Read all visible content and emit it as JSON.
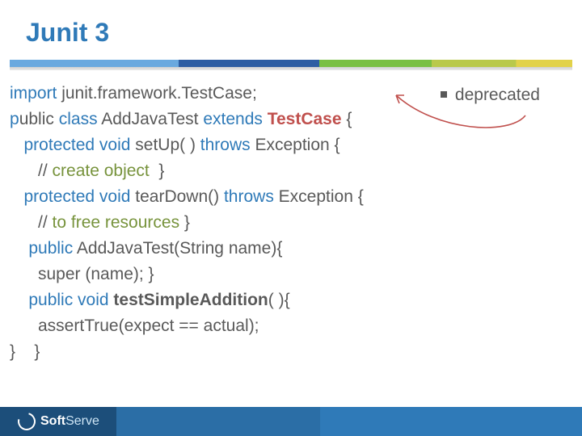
{
  "title": "Junit 3",
  "note": "deprecated",
  "code": {
    "l1a": "import",
    "l1b": " junit.framework.TestCase;",
    "l2a": "p",
    "l2b": "ublic ",
    "l2c": "class ",
    "l2d": "AddJavaTest ",
    "l2e": "extends ",
    "l2f": "TestCase",
    "l2g": " {",
    "l3a": "   protected void ",
    "l3b": "setUp( ) ",
    "l3c": "throws ",
    "l3d": "Exception {",
    "l4a": "      // ",
    "l4b": "create object",
    "l4c": "  }",
    "l5a": "   protected void ",
    "l5b": "tearDown() ",
    "l5c": "throws ",
    "l5d": "Exception {",
    "l6a": "      // ",
    "l6b": "to free resources",
    "l6c": " }",
    "l7a": "    public ",
    "l7b": "AddJavaTest(String name){",
    "l8": "      super (name); }",
    "l9a": "    public void ",
    "l9b": "testSimpleAddition",
    "l9c": "( ){",
    "l10": "      assertTrue(expect == actual);",
    "l11": "}    }"
  },
  "footer": {
    "brand": "Soft",
    "brand2": "Serve"
  }
}
